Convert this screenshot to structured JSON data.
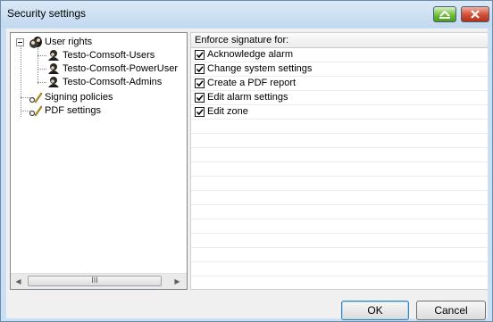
{
  "window": {
    "title": "Security settings"
  },
  "tree": {
    "root": {
      "label": "User rights",
      "icon": "users-group-icon"
    },
    "users": [
      {
        "label": "Testo-Comsoft-Users",
        "icon": "user-icon"
      },
      {
        "label": "Testo-Comsoft-PowerUser",
        "icon": "user-icon"
      },
      {
        "label": "Testo-Comsoft-Admins",
        "icon": "user-icon"
      }
    ],
    "others": [
      {
        "label": "Signing policies",
        "icon": "pen-key-icon"
      },
      {
        "label": "PDF settings",
        "icon": "pen-key-icon"
      }
    ],
    "scrollbar_thumb_grip": "III"
  },
  "grid": {
    "header": "Enforce signature for:",
    "rows": [
      {
        "label": "Acknowledge alarm",
        "checked": true
      },
      {
        "label": "Change system settings",
        "checked": true
      },
      {
        "label": "Create a PDF report",
        "checked": true
      },
      {
        "label": "Edit alarm settings",
        "checked": true
      },
      {
        "label": "Edit zone",
        "checked": true
      }
    ]
  },
  "buttons": {
    "ok": "OK",
    "cancel": "Cancel"
  },
  "colors": {
    "titlebar": "#c2d8ef",
    "close": "#d5533a",
    "minimize": "#6fbf3a"
  }
}
